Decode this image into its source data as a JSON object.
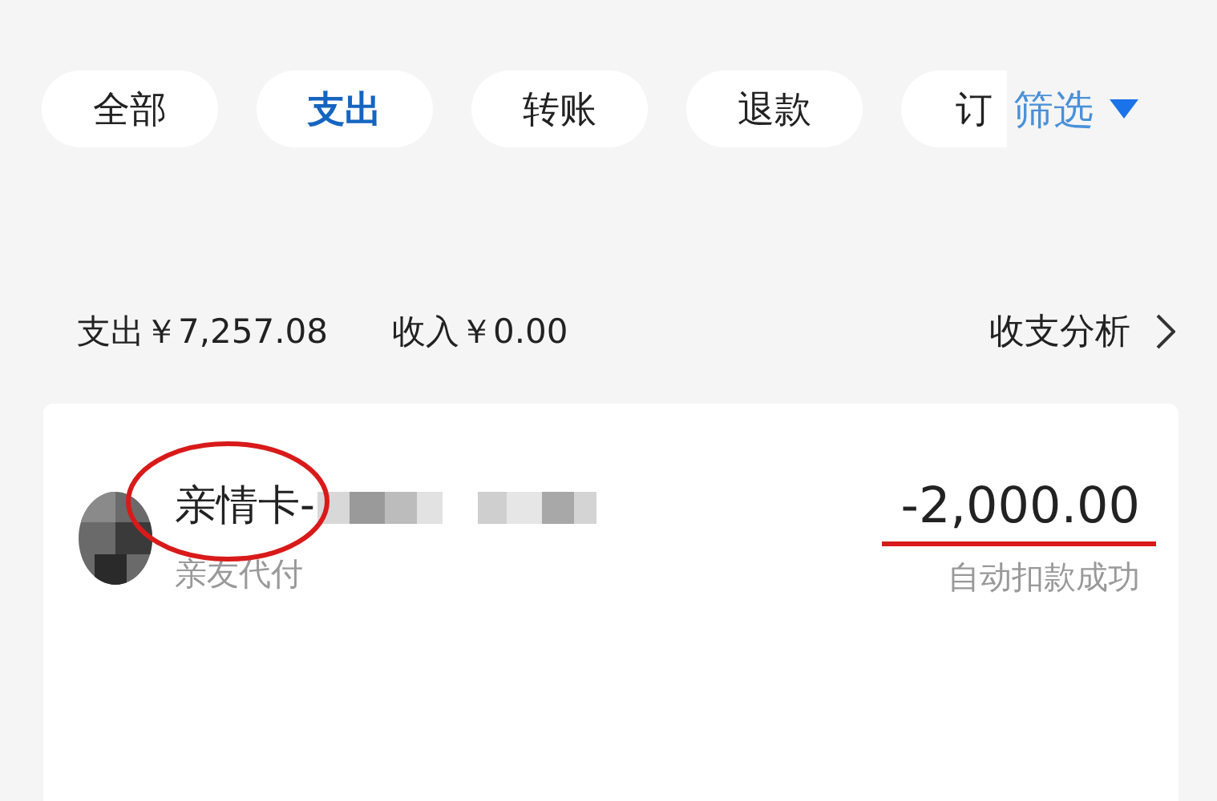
{
  "tabs": [
    {
      "label": "全部",
      "selected": false
    },
    {
      "label": "支出",
      "selected": true
    },
    {
      "label": "转账",
      "selected": false
    },
    {
      "label": "退款",
      "selected": false
    },
    {
      "label": "订",
      "selected": false
    }
  ],
  "filter": {
    "label": "筛选"
  },
  "summary": {
    "expense": "支出￥7,257.08",
    "income": "收入￥0.00",
    "analysis": "收支分析"
  },
  "transactions": [
    {
      "name": "亲情卡-",
      "category": "亲友代付",
      "amount": "-2,000.00",
      "status": "自动扣款成功",
      "circled": true,
      "underlined": true
    }
  ]
}
